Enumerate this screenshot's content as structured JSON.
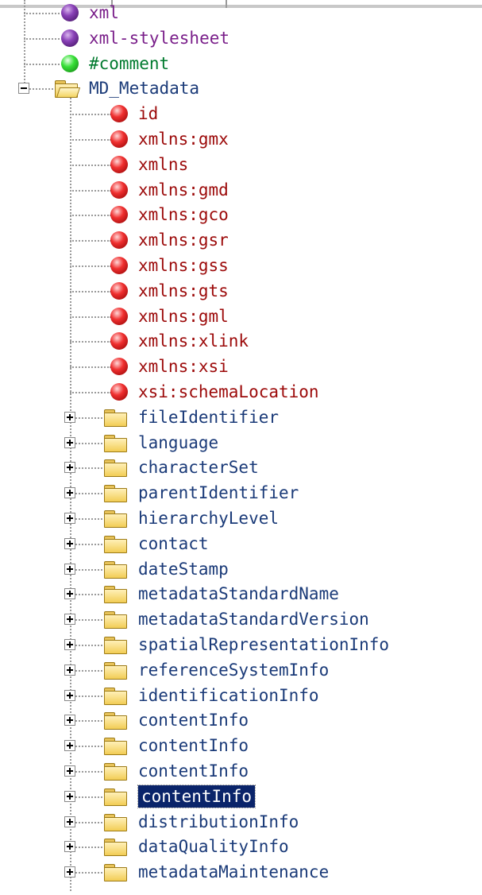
{
  "tree": {
    "top_nodes": [
      {
        "label": "xml",
        "icon": "purple-ball-icon",
        "color": "#7a1f8a"
      },
      {
        "label": "xml-stylesheet",
        "icon": "purple-ball-icon",
        "color": "#7a1f8a"
      },
      {
        "label": "#comment",
        "icon": "green-ball-icon",
        "color": "#007a2e"
      }
    ],
    "root": {
      "label": "MD_Metadata",
      "expanded": true,
      "icon": "open-folder-icon"
    },
    "attributes": [
      "id",
      "xmlns:gmx",
      "xmlns",
      "xmlns:gmd",
      "xmlns:gco",
      "xmlns:gsr",
      "xmlns:gss",
      "xmlns:gts",
      "xmlns:gml",
      "xmlns:xlink",
      "xmlns:xsi",
      "xsi:schemaLocation"
    ],
    "elements": [
      "fileIdentifier",
      "language",
      "characterSet",
      "parentIdentifier",
      "hierarchyLevel",
      "contact",
      "dateStamp",
      "metadataStandardName",
      "metadataStandardVersion",
      "spatialRepresentationInfo",
      "referenceSystemInfo",
      "identificationInfo",
      "contentInfo",
      "contentInfo",
      "contentInfo",
      "contentInfo",
      "distributionInfo",
      "dataQualityInfo",
      "metadataMaintenance"
    ],
    "selected_element_index": 15,
    "colors": {
      "attribute_text": "#9c0a0a",
      "element_text": "#1a3a78",
      "selection_bg": "#0a246a",
      "selection_text": "#ffffff"
    }
  }
}
